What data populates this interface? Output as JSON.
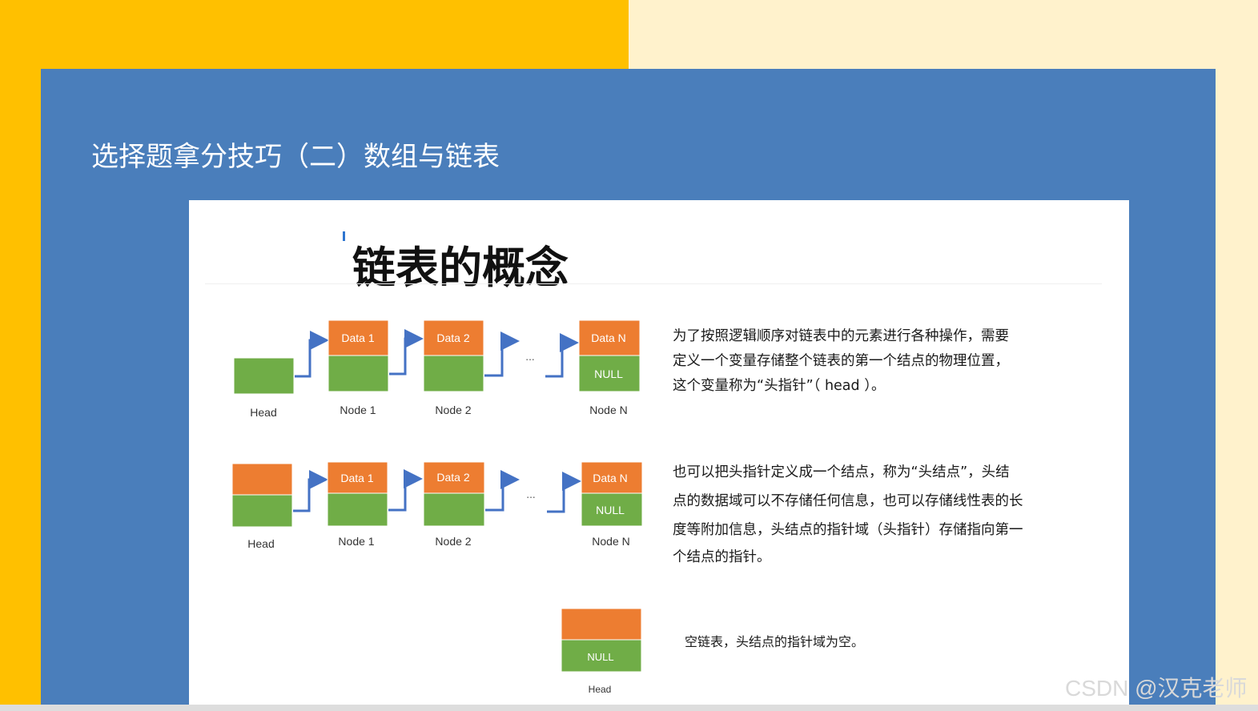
{
  "slide": {
    "title": "选择题拿分技巧（二）数组与链表",
    "card_title": "链表的概念",
    "watermark": "CSDN @汉克老师"
  },
  "colors": {
    "orange": "#ED7D31",
    "green": "#70AD47",
    "arrow": "#4472C4",
    "panel_blue": "#4A7EBB",
    "gold": "#FFC000",
    "cream": "#FFF2CC"
  },
  "diagram": {
    "row1": {
      "head_label": "Head",
      "nodes": [
        {
          "data": "Data 1",
          "label": "Node 1"
        },
        {
          "data": "Data 2",
          "label": "Node 2"
        },
        {
          "data": "Data N",
          "next": "NULL",
          "label": "Node N"
        }
      ],
      "ellipsis": "..."
    },
    "row2": {
      "head_label": "Head",
      "nodes": [
        {
          "data": "Data 1",
          "label": "Node 1"
        },
        {
          "data": "Data 2",
          "label": "Node 2"
        },
        {
          "data": "Data N",
          "next": "NULL",
          "label": "Node N"
        }
      ],
      "ellipsis": "..."
    },
    "row3": {
      "next": "NULL",
      "head_label": "Head"
    }
  },
  "text": {
    "para1": [
      "为了按照逻辑顺序对链表中的元素进行各种操作，需要",
      "定义一个变量存储整个链表的第一个结点的物理位置，",
      "这个变量称为“头指针”（    head ）。"
    ],
    "para2": [
      "也可以把头指针定义成一个结点，称为“头结点”，头结",
      "点的数据域可以不存储任何信息，也可以存储线性表的长",
      "度等附加信息，头结点的指针域（头指针）存储指向第一",
      "个结点的指针。"
    ],
    "para3": [
      "空链表，头结点的指针域为空。"
    ]
  }
}
